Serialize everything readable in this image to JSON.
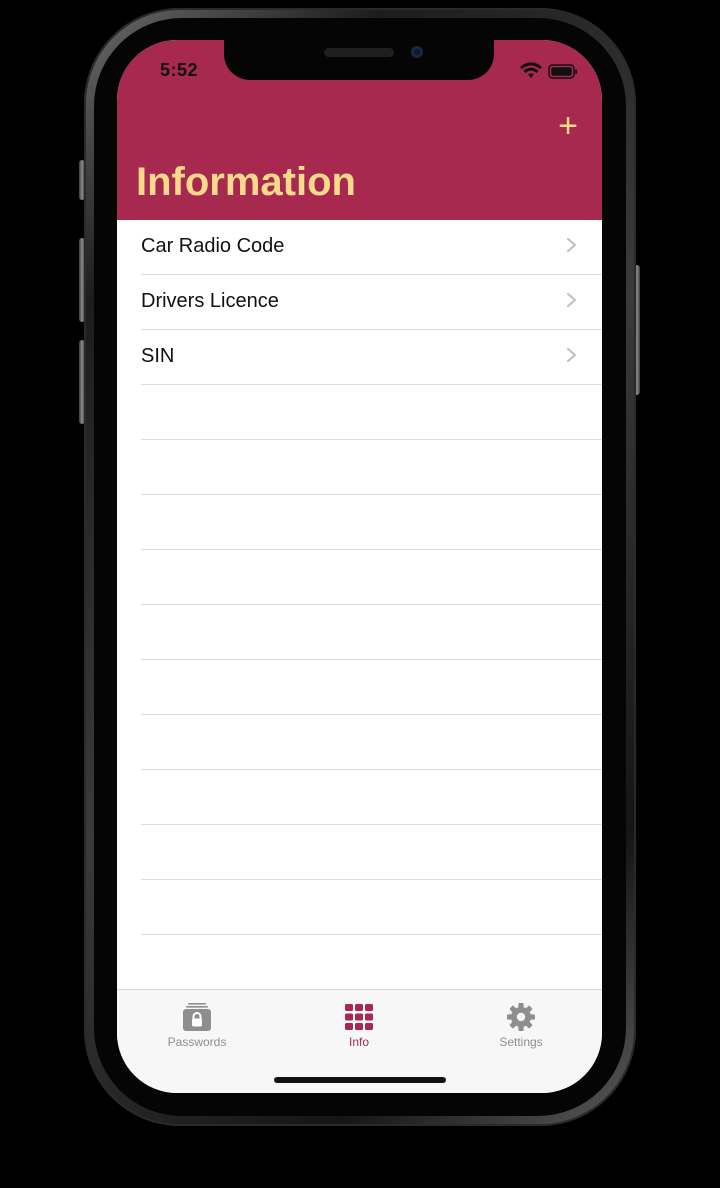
{
  "status_bar": {
    "time": "5:52"
  },
  "header": {
    "title": "Information",
    "add_label": "+",
    "accent_color": "#a8294f",
    "title_color": "#f9d98a"
  },
  "list": {
    "items": [
      {
        "label": "Car Radio Code"
      },
      {
        "label": "Drivers Licence"
      },
      {
        "label": "SIN"
      }
    ]
  },
  "tab_bar": {
    "tabs": [
      {
        "label": "Passwords",
        "icon": "lock-folder-icon",
        "active": false
      },
      {
        "label": "Info",
        "icon": "grid-icon",
        "active": true
      },
      {
        "label": "Settings",
        "icon": "gear-icon",
        "active": false
      }
    ]
  }
}
